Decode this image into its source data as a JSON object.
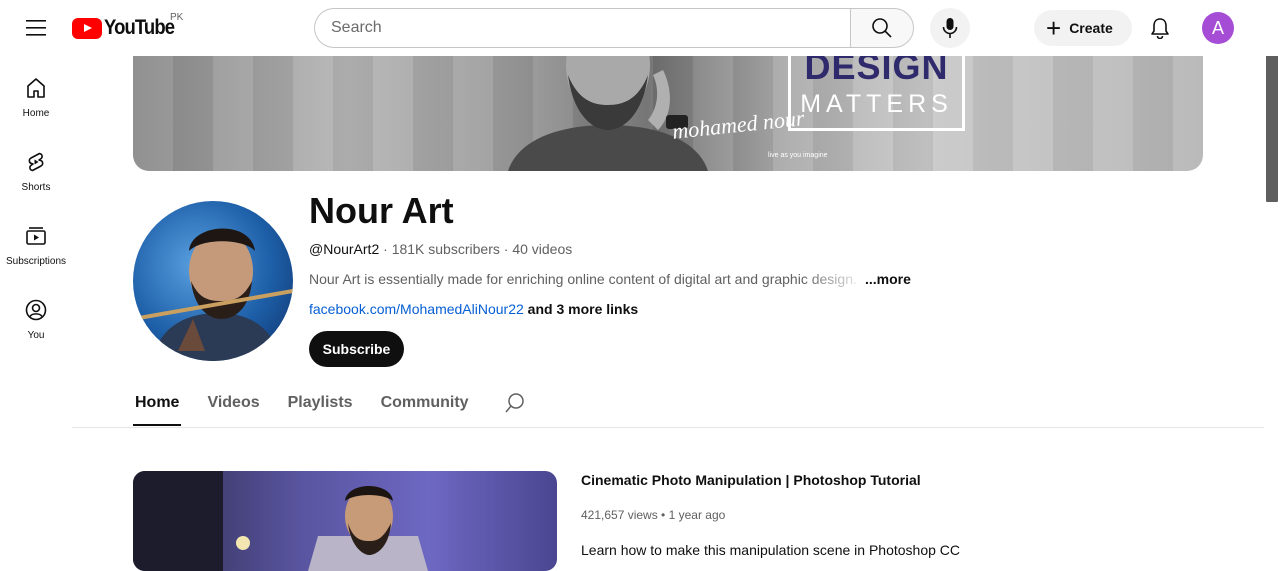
{
  "header": {
    "logo_text": "YouTube",
    "region": "PK",
    "search_placeholder": "Search",
    "create_label": "Create",
    "avatar_letter": "A"
  },
  "guide": {
    "items": [
      {
        "label": "Home",
        "icon": "home-icon"
      },
      {
        "label": "Shorts",
        "icon": "shorts-icon"
      },
      {
        "label": "Subscriptions",
        "icon": "subscriptions-icon"
      },
      {
        "label": "You",
        "icon": "you-icon"
      }
    ]
  },
  "banner": {
    "design": "DESIGN",
    "matters": "MATTERS",
    "signature": "mohamed nour",
    "tagline": "live as you imagine"
  },
  "channel": {
    "name": "Nour Art",
    "handle": "@NourArt2",
    "subscribers": "181K subscribers",
    "videos": "40 videos",
    "separator": " · ",
    "description": "Nour Art is essentially made for enriching online content of digital art and graphic design.",
    "more": "...more",
    "link": "facebook.com/MohamedAliNour22",
    "more_links": " and 3 more links",
    "subscribe_label": "Subscribe"
  },
  "tabs": [
    {
      "label": "Home",
      "active": true
    },
    {
      "label": "Videos"
    },
    {
      "label": "Playlists"
    },
    {
      "label": "Community"
    }
  ],
  "featured_video": {
    "title": "Cinematic Photo Manipulation | Photoshop Tutorial",
    "views": "421,657 views",
    "dot": " • ",
    "age": "1 year ago",
    "description": "Learn how to make this manipulation scene in Photoshop CC"
  },
  "colors": {
    "brand_red": "#ff0000",
    "link_blue": "#065fd4",
    "avatar_purple": "#a64dd6"
  }
}
